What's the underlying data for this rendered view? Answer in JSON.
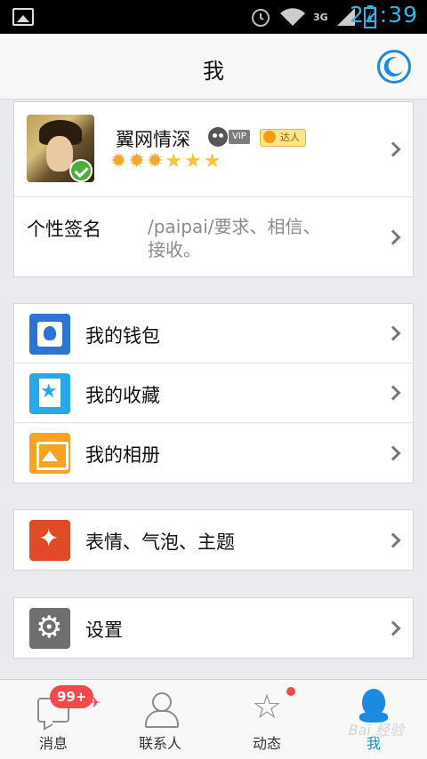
{
  "status_bar": {
    "time": "22:39",
    "network": "3G"
  },
  "header": {
    "title": "我"
  },
  "profile": {
    "nickname": "翼网情深",
    "vip_tag": "VIP",
    "daren_tag": "达人",
    "level_icons": [
      "sun",
      "sun",
      "sun",
      "star",
      "star",
      "star"
    ]
  },
  "signature": {
    "label": "个性签名",
    "value": "/paipai/要求、相信、接收。"
  },
  "menu": {
    "wallet": "我的钱包",
    "favorites": "我的收藏",
    "album": "我的相册",
    "emoji": "表情、气泡、主题",
    "settings": "设置"
  },
  "tabs": {
    "messages": "消息",
    "messages_badge": "99+",
    "contacts": "联系人",
    "feed": "动态",
    "me": "我"
  },
  "colors": {
    "accent": "#1a8ae3",
    "badge": "#f24a4a",
    "background": "#e9ebef"
  },
  "watermark": "Bai 经验"
}
